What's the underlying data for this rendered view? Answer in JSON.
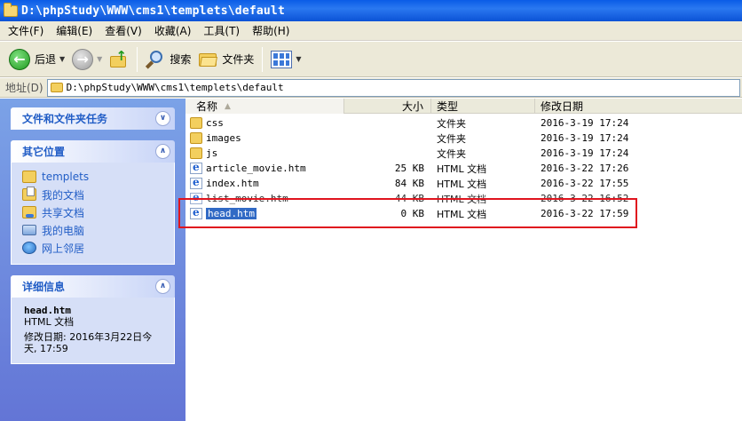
{
  "window": {
    "title": "D:\\phpStudy\\WWW\\cms1\\templets\\default"
  },
  "menu": [
    "文件(F)",
    "编辑(E)",
    "查看(V)",
    "收藏(A)",
    "工具(T)",
    "帮助(H)"
  ],
  "toolbar": {
    "back_label": "后退",
    "search_label": "搜索",
    "folders_label": "文件夹"
  },
  "address": {
    "label": "地址(D)",
    "value": "D:\\phpStudy\\WWW\\cms1\\templets\\default"
  },
  "left_pane": {
    "tasks_title": "文件和文件夹任务",
    "places_title": "其它位置",
    "places": [
      {
        "label": "templets",
        "icon": "folder-icon"
      },
      {
        "label": "我的文档",
        "icon": "documents-icon"
      },
      {
        "label": "共享文档",
        "icon": "shared-documents-icon"
      },
      {
        "label": "我的电脑",
        "icon": "computer-icon"
      },
      {
        "label": "网上邻居",
        "icon": "network-icon"
      }
    ],
    "details_title": "详细信息",
    "details": {
      "name": "head.htm",
      "type": "HTML 文档",
      "modified_line1": "修改日期: 2016年3月22日今",
      "modified_line2": "天, 17:59"
    }
  },
  "columns": {
    "name": "名称",
    "size": "大小",
    "type": "类型",
    "date": "修改日期"
  },
  "files": [
    {
      "name": "css",
      "size": "",
      "type": "文件夹",
      "date": "2016-3-19 17:24",
      "icon": "folder-icon"
    },
    {
      "name": "images",
      "size": "",
      "type": "文件夹",
      "date": "2016-3-19 17:24",
      "icon": "folder-icon"
    },
    {
      "name": "js",
      "size": "",
      "type": "文件夹",
      "date": "2016-3-19 17:24",
      "icon": "folder-icon"
    },
    {
      "name": "article_movie.htm",
      "size": "25 KB",
      "type": "HTML 文档",
      "date": "2016-3-22 17:26",
      "icon": "html-file-icon"
    },
    {
      "name": "index.htm",
      "size": "84 KB",
      "type": "HTML 文档",
      "date": "2016-3-22 17:55",
      "icon": "html-file-icon"
    },
    {
      "name": "list_movie.htm",
      "size": "44 KB",
      "type": "HTML 文档",
      "date": "2016-3-22 16:52",
      "icon": "html-file-icon"
    },
    {
      "name": "head.htm",
      "size": "0 KB",
      "type": "HTML 文档",
      "date": "2016-3-22 17:59",
      "icon": "html-file-icon",
      "selected": true
    }
  ],
  "colors": {
    "highlight_box": "#e0141e",
    "selection": "#316ac5",
    "titlebar": "#0a5ce6"
  }
}
